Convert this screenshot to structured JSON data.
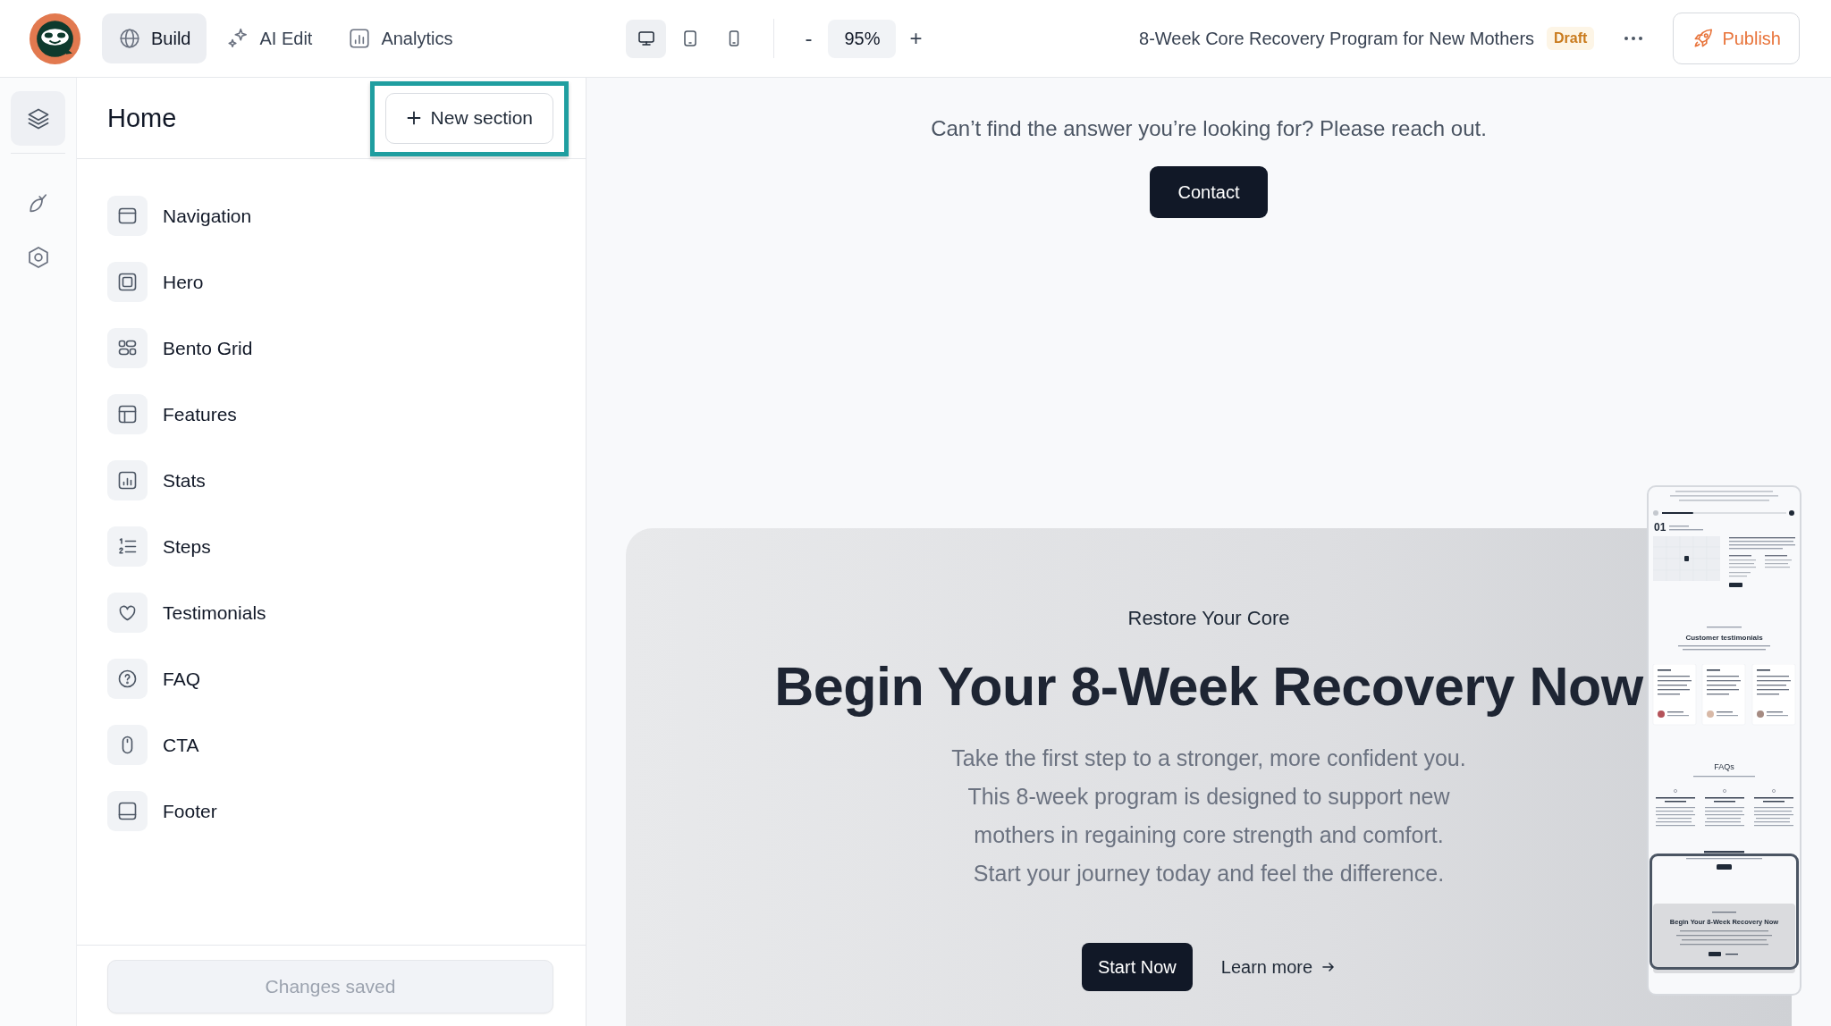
{
  "topbar": {
    "tabs": [
      {
        "label": "Build",
        "kind": "globe",
        "selected": true
      },
      {
        "label": "AI Edit",
        "kind": "sparkles",
        "selected": false
      },
      {
        "label": "Analytics",
        "kind": "chart",
        "selected": false
      }
    ],
    "devices": [
      {
        "kind": "desktop",
        "selected": true
      },
      {
        "kind": "tablet",
        "selected": false
      },
      {
        "kind": "mobile",
        "selected": false
      }
    ],
    "zoom": {
      "decrease": "-",
      "value": "95%",
      "increase": "+"
    },
    "page_title": "8-Week Core Recovery Program for New Mothers",
    "status_badge": "Draft",
    "publish_button": "Publish"
  },
  "rail": [
    {
      "kind": "layers",
      "selected": true
    },
    {
      "kind": "leaf",
      "selected": false
    },
    {
      "kind": "settings",
      "selected": false
    }
  ],
  "sections_panel": {
    "title": "Home",
    "new_section_button": {
      "label": "New section",
      "highlighted": true
    },
    "sections": [
      {
        "label": "Navigation",
        "kind": "navigation"
      },
      {
        "label": "Hero",
        "kind": "hero"
      },
      {
        "label": "Bento Grid",
        "kind": "bento"
      },
      {
        "label": "Features",
        "kind": "features"
      },
      {
        "label": "Stats",
        "kind": "stats"
      },
      {
        "label": "Steps",
        "kind": "steps"
      },
      {
        "label": "Testimonials",
        "kind": "testimonials"
      },
      {
        "label": "FAQ",
        "kind": "faq"
      },
      {
        "label": "CTA",
        "kind": "cta"
      },
      {
        "label": "Footer",
        "kind": "footer"
      }
    ],
    "save_button": {
      "label": "Changes saved",
      "disabled": true
    }
  },
  "canvas": {
    "contact_block": {
      "text": "Can’t find the answer you’re looking for? Please reach out.",
      "button": "Contact"
    },
    "cta_section": {
      "eyebrow": "Restore Your Core",
      "heading": "Begin Your 8-Week Recovery Now",
      "body": "Take the first step to a stronger, more confident you.\nThis 8-week program is designed to support new\nmothers in regaining core strength and comfort.\nStart your journey today and feel the difference.",
      "primary_button": "Start Now",
      "secondary_link": "Learn more"
    },
    "page_preview": {
      "progress": {
        "level": 0.25
      },
      "step_number": "01",
      "testimonials_heading": "Customer testimonials",
      "faq_heading": "FAQs",
      "cta_heading": "Begin Your 8-Week Recovery Now"
    }
  }
}
